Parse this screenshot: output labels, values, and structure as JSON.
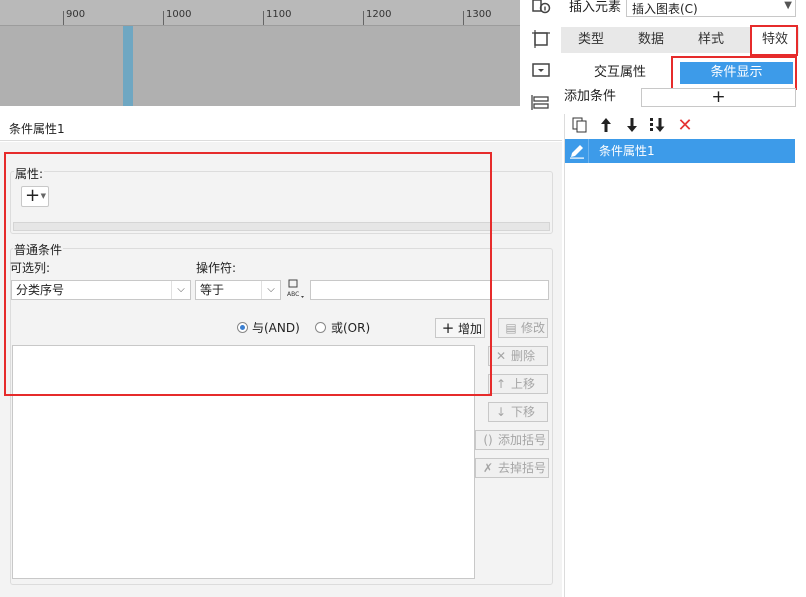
{
  "ruler": {
    "labels": [
      "900",
      "1000",
      "1100",
      "1200",
      "1300"
    ]
  },
  "toolbar_right": {
    "insert_element_label": "插入元素",
    "insert_chart_value": "插入图表(C)"
  },
  "tabs": [
    {
      "label": "类型"
    },
    {
      "label": "数据"
    },
    {
      "label": "样式"
    },
    {
      "label": "特效",
      "active": true
    }
  ],
  "subtabs": [
    {
      "label": "交互属性"
    },
    {
      "label": "条件显示",
      "active": true
    }
  ],
  "add_condition": {
    "label": "添加条件",
    "button": "+"
  },
  "condition_list": {
    "items": [
      {
        "label": "条件属性1",
        "selected": true
      }
    ]
  },
  "editor": {
    "title": "条件属性1",
    "property_group": {
      "label": "属性:",
      "add_button": "+"
    },
    "common_group": {
      "label": "普通条件",
      "column_label": "可选列:",
      "column_value": "分类序号",
      "operator_label": "操作符:",
      "operator_value": "等于",
      "value_input": "",
      "and_label": "与(AND)",
      "or_label": "或(OR)",
      "selected_logic": "and"
    },
    "buttons": {
      "add": "增加",
      "modify": "修改",
      "delete": "删除",
      "move_up": "上移",
      "move_down": "下移",
      "add_bracket": "添加括号",
      "remove_bracket": "去掉括号"
    }
  },
  "colors": {
    "accent_blue": "#3d9be9",
    "highlight_red": "#e62b2b",
    "delete_red": "#e53333"
  }
}
